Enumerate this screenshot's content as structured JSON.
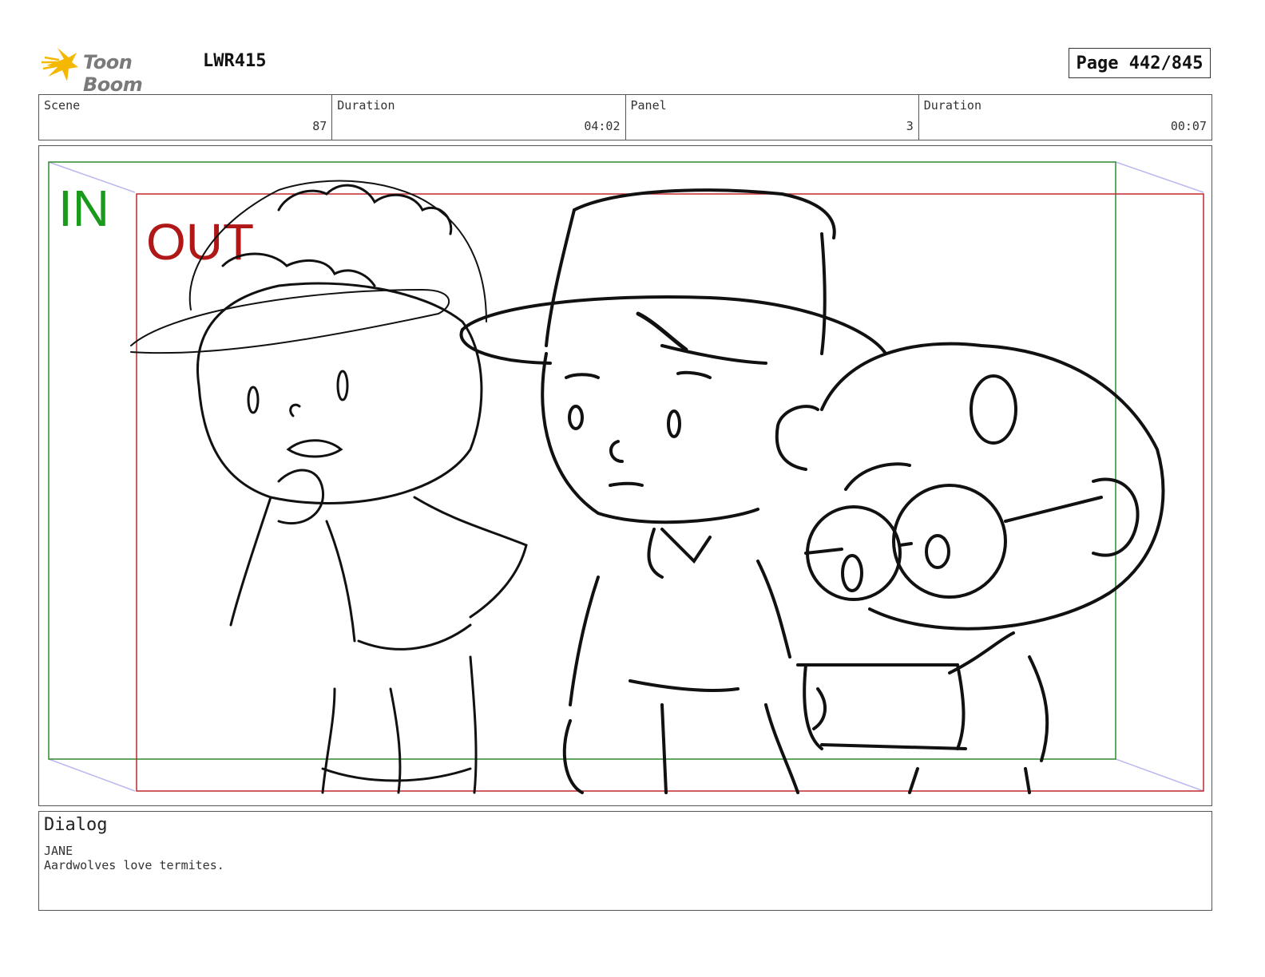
{
  "header": {
    "logo_text": "Toon Boom",
    "project_code": "LWR415",
    "page_label": "Page 442/845"
  },
  "info_bar": {
    "scene_label": "Scene",
    "scene_value": "87",
    "scene_duration_label": "Duration",
    "scene_duration_value": "04:02",
    "panel_label": "Panel",
    "panel_value": "3",
    "panel_duration_label": "Duration",
    "panel_duration_value": "00:07"
  },
  "panel": {
    "in_label": "IN",
    "out_label": "OUT",
    "in_color": "#1a9a1a",
    "out_color": "#b01818"
  },
  "dialog": {
    "title": "Dialog",
    "speaker": "JANE",
    "line": "Aardwolves love termites."
  },
  "colors": {
    "logo_star": "#f5b800",
    "frame_in": "#2e8b2e",
    "frame_out": "#c0282c",
    "camera_path": "#b9b9ee"
  }
}
